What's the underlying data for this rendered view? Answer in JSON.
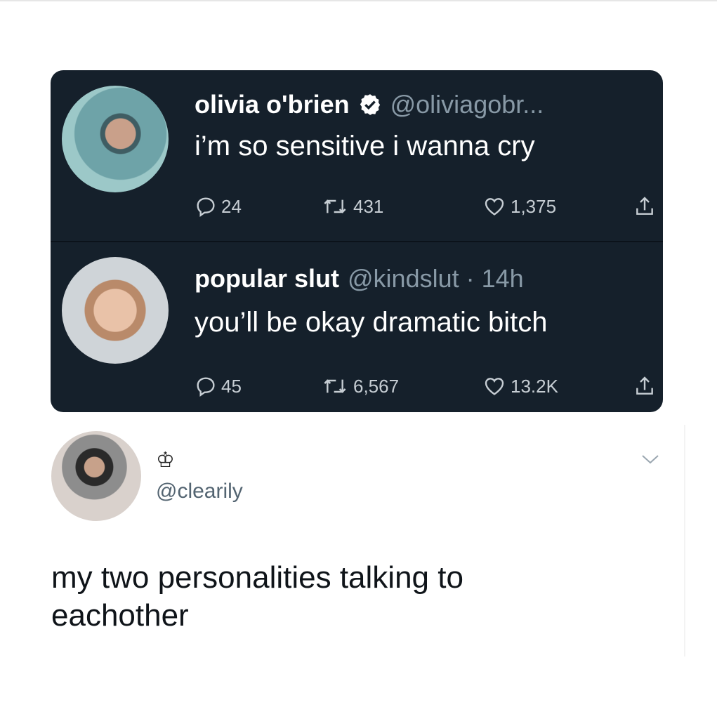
{
  "tweets": [
    {
      "name": "olivia o'brien",
      "verified": true,
      "handle": "@oliviagobr...",
      "text": "i’m so sensitive i wanna cry",
      "replies": "24",
      "retweets": "431",
      "likes": "1,375"
    },
    {
      "name": "popular slut",
      "handle": "@kindslut · 14h",
      "text": "you’ll be okay dramatic bitch",
      "replies": "45",
      "retweets": "6,567",
      "likes": "13.2K"
    }
  ],
  "post": {
    "display_name": "♔",
    "handle": "@clearily",
    "caption_lines": [
      "my two personalities talking to",
      "eachother"
    ]
  },
  "icons": {
    "reply": "reply-icon",
    "retweet": "retweet-icon",
    "like": "heart-icon",
    "share": "share-icon",
    "verified": "verified-badge-icon",
    "more": "chevron-down-icon"
  },
  "colors": {
    "card_bg": "#15202b",
    "muted": "#8899a6",
    "handle_light": "#536471"
  }
}
